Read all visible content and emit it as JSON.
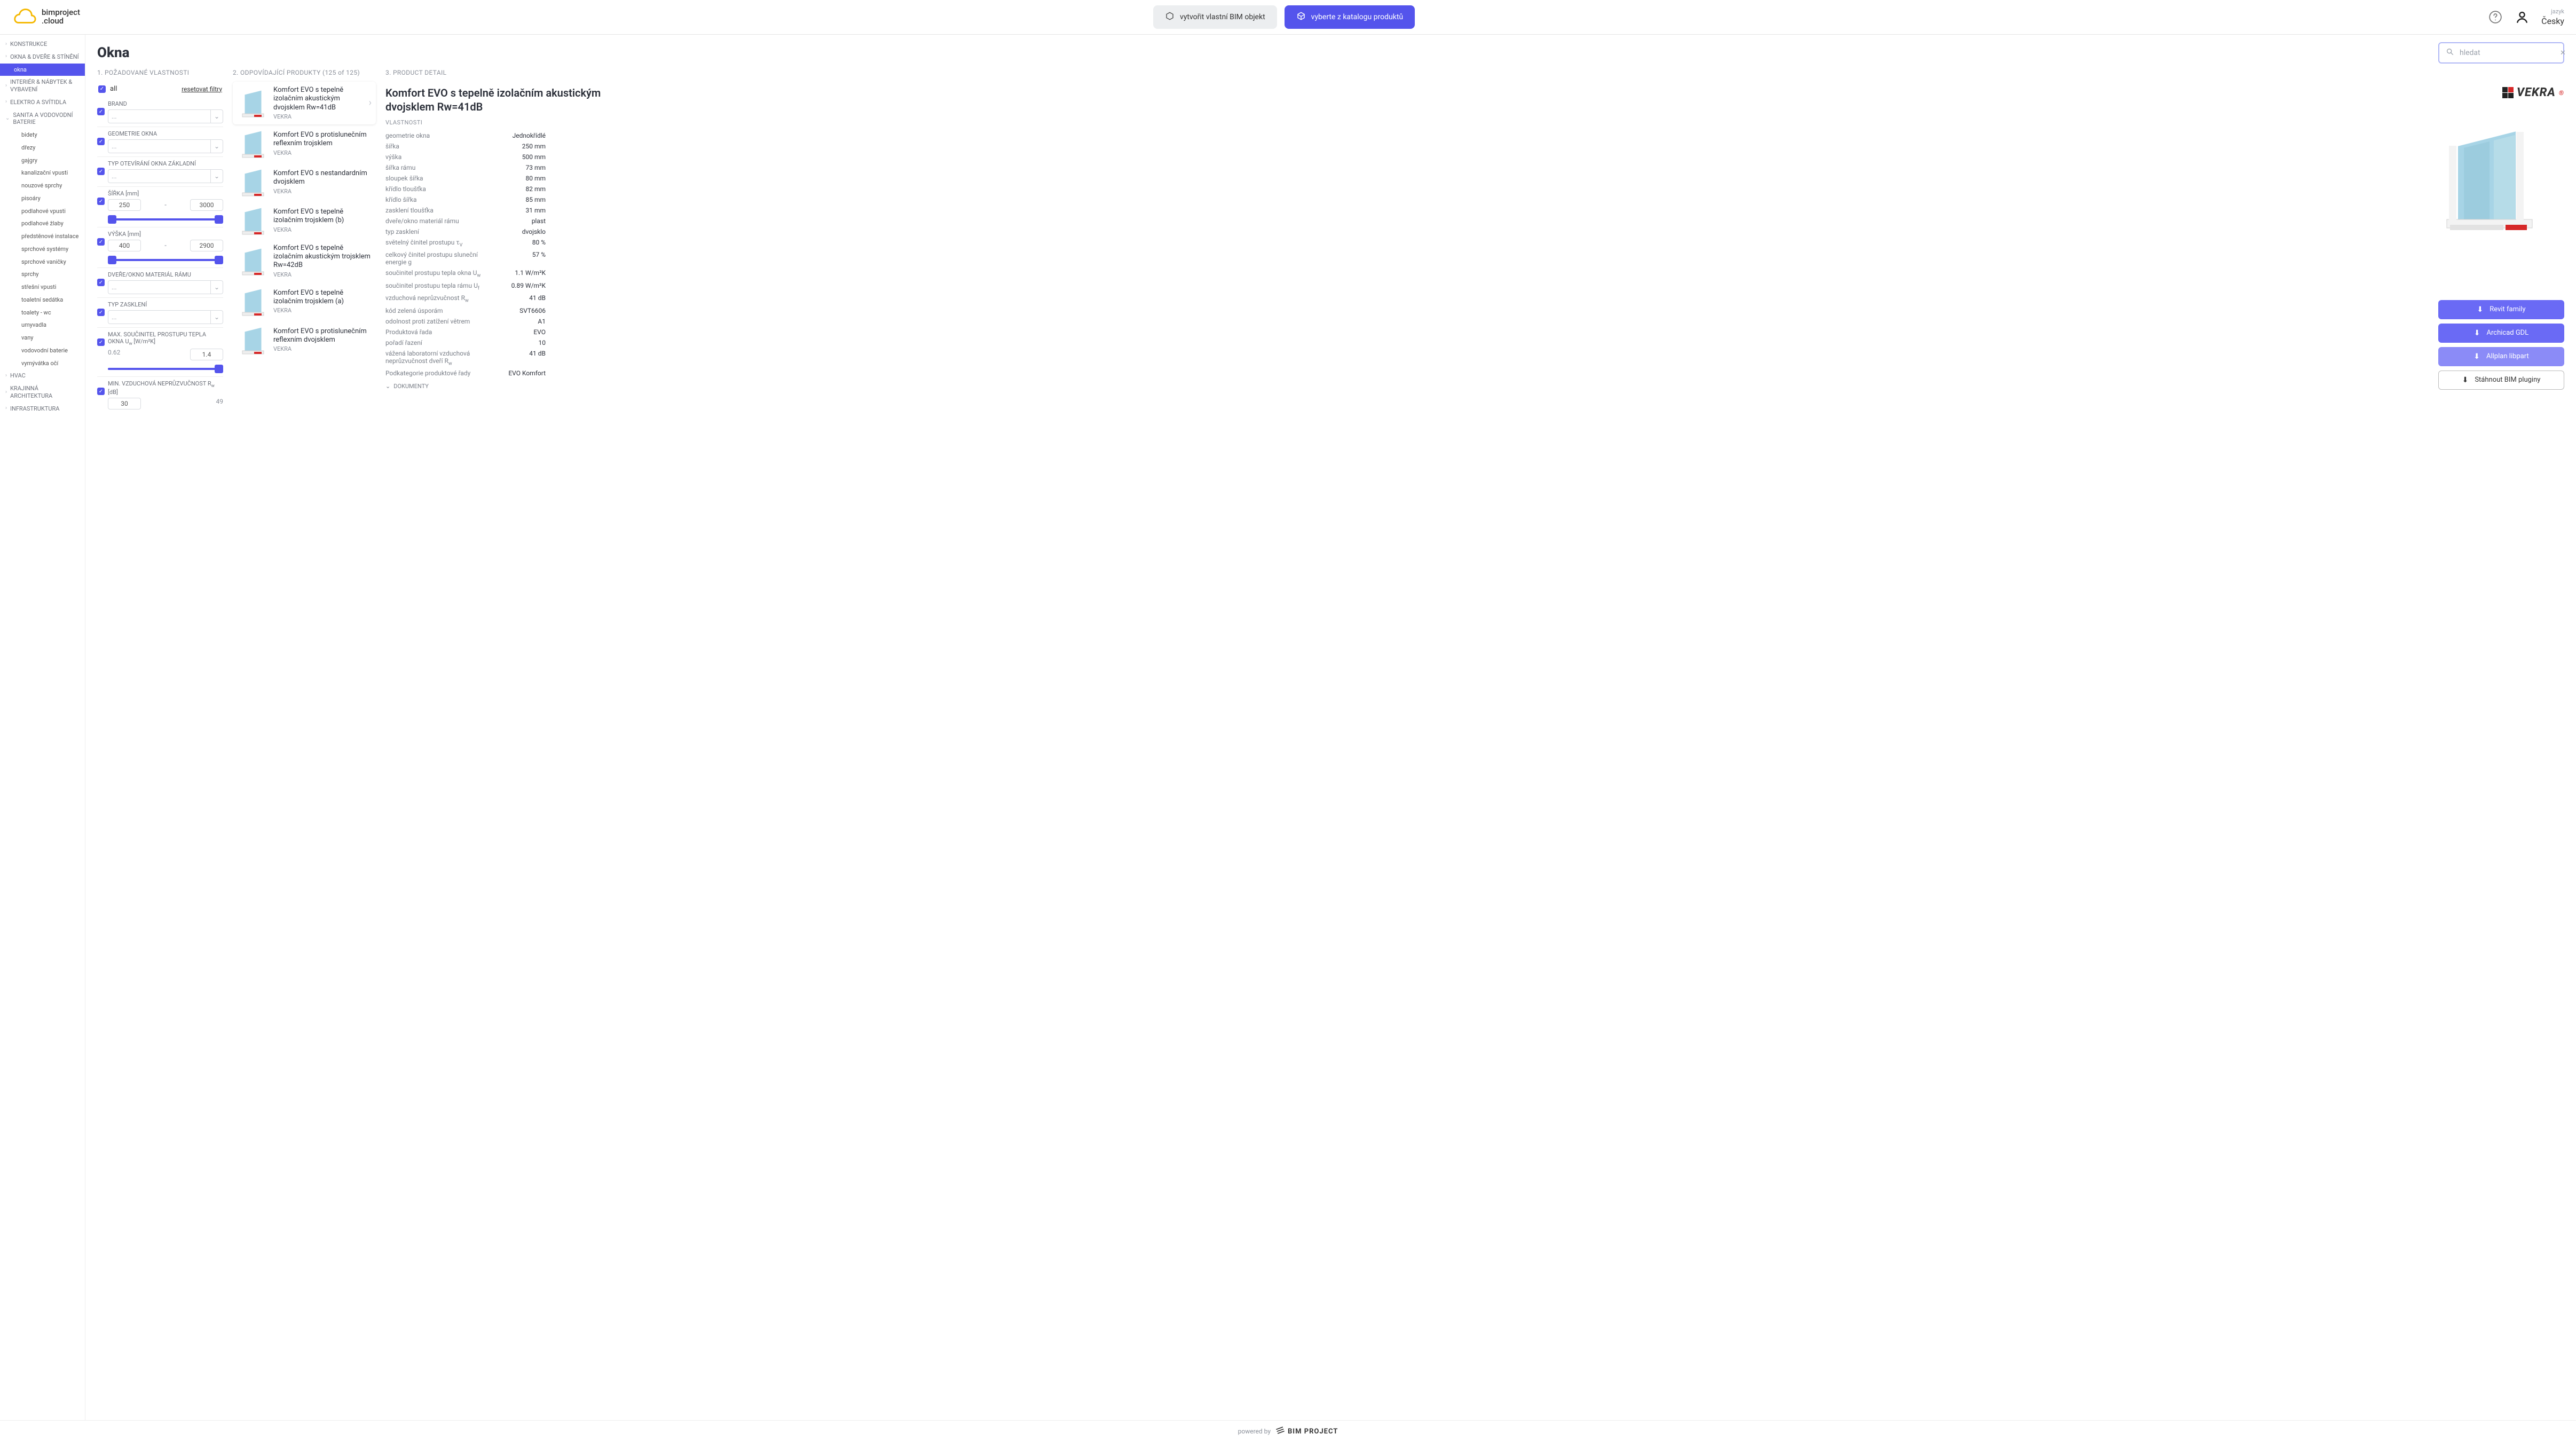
{
  "header": {
    "logo1": "bimproject",
    "logo2": ".cloud",
    "btn_create": "vytvořit vlastní BIM objekt",
    "btn_catalog": "vyberte z katalogu produktů",
    "lang_label": "jazyk",
    "lang_value": "Česky"
  },
  "search": {
    "placeholder": "hledat"
  },
  "page_title": "Okna",
  "sidebar": {
    "top": [
      {
        "label": "KONSTRUKCE"
      },
      {
        "label": "OKNA & DVEŘE & STÍNĚNÍ"
      }
    ],
    "active": "okna",
    "mid": [
      {
        "label": "INTERIÉR & NÁBYTEK & VYBAVENÍ"
      },
      {
        "label": "ELEKTRO A SVÍTIDLA"
      },
      {
        "label": "SANITA A VODOVODNÍ BATERIE"
      }
    ],
    "sanita": [
      "bidety",
      "dřezy",
      "gajgry",
      "kanalizační vpusti",
      "nouzové sprchy",
      "pisoáry",
      "podlahové vpusti",
      "podlahové žlaby",
      "předstěnové instalace",
      "sprchové systémy",
      "sprchové vaničky",
      "sprchy",
      "střešní vpusti",
      "toaletní sedátka",
      "toalety - wc",
      "umyvadla",
      "vany",
      "vodovodní baterie",
      "vymývátka očí"
    ],
    "bottom": [
      {
        "label": "HVAC"
      },
      {
        "label": "KRAJINNÁ ARCHITEKTURA"
      },
      {
        "label": "INFRASTRUKTURA"
      }
    ]
  },
  "cols": {
    "c1": "1. POŽADOVANÉ VLASTNOSTI",
    "c2": "2. ODPOVÍDAJÍCÍ PRODUKTY (125 of 125)",
    "c3": "3. PRODUCT DETAIL"
  },
  "filters": {
    "all": "all",
    "reset": "resetovat filtry",
    "groups": [
      {
        "label": "BRAND",
        "type": "select",
        "ph": "..."
      },
      {
        "label": "GEOMETRIE OKNA",
        "type": "select",
        "ph": "..."
      },
      {
        "label": "TYP OTEVÍRÁNÍ OKNA ZÁKLADNÍ",
        "type": "select",
        "ph": "..."
      },
      {
        "label": "ŠÍŘKA [mm]",
        "type": "range",
        "min": "250",
        "max": "3000"
      },
      {
        "label": "VÝŠKA [mm]",
        "type": "range",
        "min": "400",
        "max": "2900"
      },
      {
        "label": "DVEŘE/OKNO MATERIÁL RÁMU",
        "type": "select",
        "ph": "..."
      },
      {
        "label": "TYP ZASKLENÍ",
        "type": "select",
        "ph": "..."
      },
      {
        "label": "MAX. SOUČINITEL PROSTUPU TEPLA OKNA U",
        "sub": "w",
        "unit": " [W/m²K]",
        "type": "halfrange",
        "lo": "0.62",
        "hi": "1.4"
      },
      {
        "label": "MIN. VZDUCHOVÁ NEPRŮZVUČNOST R",
        "sub": "w",
        "unit": " [dB]",
        "type": "minrange",
        "lo": "30",
        "hi": "49"
      }
    ]
  },
  "products": [
    {
      "name": "Komfort EVO s tepelně izolačním akustickým dvojsklem Rw=41dB",
      "brand": "VEKRA",
      "sel": true
    },
    {
      "name": "Komfort EVO s protislunečním reflexním trojsklem",
      "brand": "VEKRA"
    },
    {
      "name": "Komfort EVO s nestandardním dvojsklem",
      "brand": "VEKRA"
    },
    {
      "name": "Komfort EVO s tepelně izolačním trojsklem (b)",
      "brand": "VEKRA"
    },
    {
      "name": "Komfort EVO s tepelně izolačním akustickým trojsklem Rw=42dB",
      "brand": "VEKRA"
    },
    {
      "name": "Komfort EVO s tepelně izolačním trojsklem (a)",
      "brand": "VEKRA"
    },
    {
      "name": "Komfort EVO s protislunečním reflexním dvojsklem",
      "brand": "VEKRA"
    }
  ],
  "detail": {
    "title": "Komfort EVO s tepelně izolačním akustickým dvojsklem Rw=41dB",
    "brand": "VEKRA",
    "props_header": "VLASTNOSTI",
    "props": [
      {
        "k": "geometrie okna",
        "v": "Jednokřídlé"
      },
      {
        "k": "šířka",
        "v": "250 mm"
      },
      {
        "k": "výška",
        "v": "500 mm"
      },
      {
        "k": "šířka rámu",
        "v": "73 mm"
      },
      {
        "k": "sloupek šířka",
        "v": "80 mm"
      },
      {
        "k": "křídlo tloušťka",
        "v": "82 mm"
      },
      {
        "k": "křídlo šířka",
        "v": "85 mm"
      },
      {
        "k": "zasklení tloušťka",
        "v": "31 mm"
      },
      {
        "k": "dveře/okno materiál rámu",
        "v": "plast"
      },
      {
        "k": "typ zasklení",
        "v": "dvojsklo"
      },
      {
        "k": "světelný činitel prostupu τ",
        "sub": "V",
        "v": "80 %"
      },
      {
        "k": "celkový činitel prostupu sluneční energie g",
        "v": "57 %"
      },
      {
        "k": "součinitel prostupu tepla okna U",
        "sub": "w",
        "v": "1.1 W/m²K"
      },
      {
        "k": "součinitel prostupu tepla rámu U",
        "sub": "f",
        "v": "0.89 W/m²K"
      },
      {
        "k": "vzduchová neprůzvučnost R",
        "sub": "w",
        "v": "41 dB"
      },
      {
        "k": "kód zelená úsporám",
        "v": "SVT6606"
      },
      {
        "k": "odolnost proti zatížení větrem",
        "v": "A1"
      },
      {
        "k": "Produktová řada",
        "v": "EVO"
      },
      {
        "k": "pořadí řazení",
        "v": "10"
      },
      {
        "k": "vážená laboratorní vzduchová neprůzvučnost dveří R",
        "sub": "w",
        "v": "41 dB"
      },
      {
        "k": "Podkategorie produktové řady",
        "v": "EVO Komfort"
      }
    ],
    "docs": "DOKUMENTY",
    "downloads": [
      {
        "label": "Revit family",
        "cls": "blue"
      },
      {
        "label": "Archicad GDL",
        "cls": "blue"
      },
      {
        "label": "Allplan libpart",
        "cls": "lblue"
      },
      {
        "label": "Stáhnout BIM pluginy",
        "cls": "out"
      }
    ]
  },
  "footer": {
    "powered": "powered by",
    "brand": "BIM PROJECT"
  }
}
